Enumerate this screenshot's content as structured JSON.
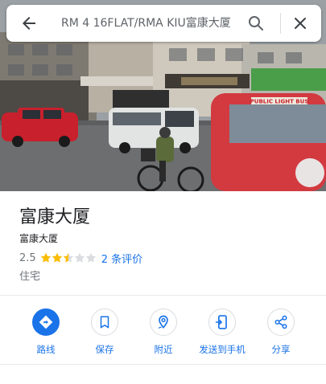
{
  "search": {
    "query": "RM 4 16FLAT/RMA KIU富康大厦"
  },
  "photo": {
    "shop_sign_text": "PUBLIC LIGHT BUS"
  },
  "place": {
    "name": "富康大厦",
    "subtitle": "富康大厦",
    "rating": "2.5",
    "rating_value": 2.5,
    "stars_total": 5,
    "reviews_label": "2 条评价",
    "category": "住宅"
  },
  "actions": [
    {
      "label": "路线",
      "icon": "directions-icon"
    },
    {
      "label": "保存",
      "icon": "bookmark-icon"
    },
    {
      "label": "附近",
      "icon": "nearby-icon"
    },
    {
      "label": "发送到手机",
      "icon": "send-to-phone-icon"
    },
    {
      "label": "分享",
      "icon": "share-icon"
    }
  ],
  "colors": {
    "accent": "#1a73e8",
    "star": "#fbbc04",
    "star_empty": "#dadce0"
  }
}
